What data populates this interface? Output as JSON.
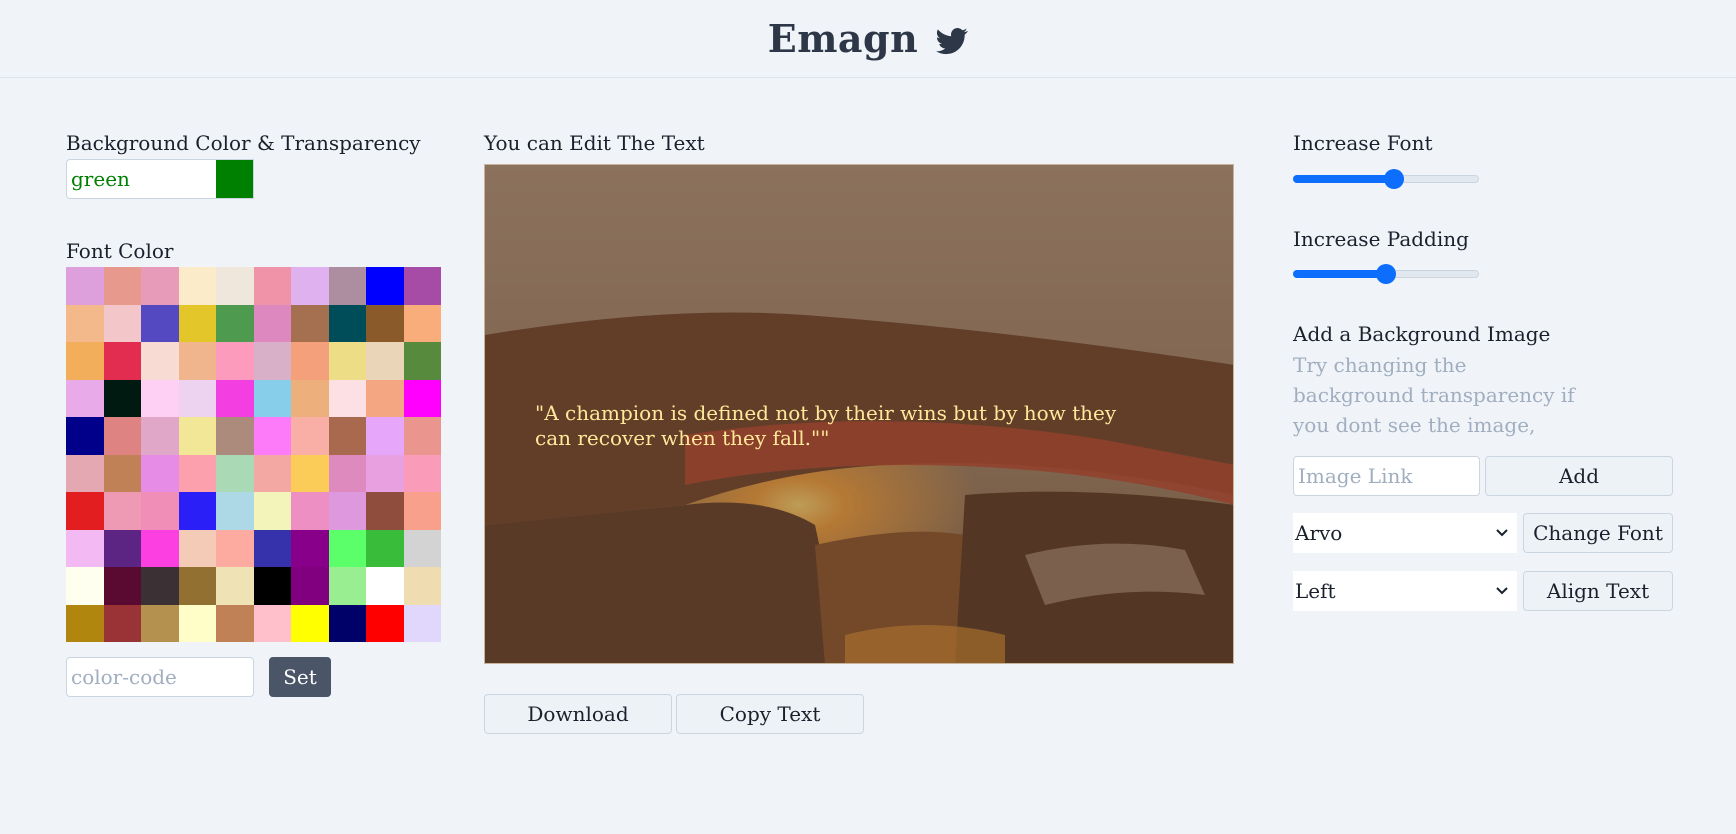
{
  "header": {
    "brand": "Emagn",
    "twitter_icon": "twitter-icon"
  },
  "left": {
    "bg_label": "Background Color & Transparency",
    "bg_value": "green",
    "bg_color": "#008000",
    "font_color_label": "Font Color",
    "palette": [
      "#dda0dd",
      "#e8998d",
      "#e89bb8",
      "#fbebc9",
      "#efe6dc",
      "#f093a8",
      "#dfb2ef",
      "#ad8ea0",
      "#0000ff",
      "#a64ca6",
      "#f4b98b",
      "#f3c6c9",
      "#5449c0",
      "#e3c62a",
      "#4e9a4e",
      "#de88c0",
      "#a5704f",
      "#004d5a",
      "#8b5a2b",
      "#f8ad7b",
      "#f3ae5c",
      "#e22d50",
      "#f8dcd3",
      "#f0b58c",
      "#fd9bbd",
      "#d8b1c8",
      "#f4a07a",
      "#eddd86",
      "#ead5b8",
      "#578a3c",
      "#e8aae9",
      "#001a11",
      "#fdd0f4",
      "#eed3f1",
      "#f33fe1",
      "#87ceeb",
      "#edaf7c",
      "#fde0e4",
      "#f4a582",
      "#ff00ff",
      "#00008b",
      "#de8282",
      "#e0a7c9",
      "#f2e697",
      "#ac8b7d",
      "#fd7af9",
      "#f9aea6",
      "#a9694f",
      "#e6a7fb",
      "#ea968f",
      "#e3a8b2",
      "#bf8155",
      "#e68ce6",
      "#fca0ad",
      "#aad9b6",
      "#f4a8a4",
      "#fbcc57",
      "#de8abf",
      "#e8a0e0",
      "#fb9bba",
      "#e21e20",
      "#ef9ab5",
      "#f18eb8",
      "#2a1ff6",
      "#add8e6",
      "#f2f4ba",
      "#ed8fc2",
      "#de99de",
      "#8f4e3d",
      "#f8a08b",
      "#f3b9f3",
      "#5c2483",
      "#fb3fe0",
      "#f3cbb7",
      "#fdaba1",
      "#3532ab",
      "#880089",
      "#5bff69",
      "#39bc3a",
      "#d3d3d3",
      "#fffff0",
      "#5a0a30",
      "#3b3134",
      "#927032",
      "#efe2b4",
      "#000000",
      "#800080",
      "#98ee90",
      "#ffffff",
      "#efdcb0",
      "#b1860f",
      "#993336",
      "#b4914f",
      "#fffec8",
      "#c08157",
      "#ffc0cb",
      "#ffff00",
      "#000069",
      "#ff0000",
      "#e1d6fb"
    ],
    "code_placeholder": "color-code",
    "set_label": "Set"
  },
  "center": {
    "edit_label": "You can Edit The Text",
    "quote": "\"A champion is defined not by their wins but by how they can recover when they fall.\"\"",
    "quote_color": "#ffe89a",
    "download_label": "Download",
    "copy_label": "Copy Text"
  },
  "right": {
    "font_label": "Increase Font",
    "font_slider_value": 0.55,
    "padding_label": "Increase Padding",
    "padding_slider_value": 0.5,
    "bg_image_label": "Add a Background Image",
    "bg_image_hint": "Try changing the background transparency if you dont see the image,",
    "image_link_placeholder": "Image Link",
    "add_label": "Add",
    "font_select_value": "Arvo",
    "change_font_label": "Change Font",
    "align_select_value": "Left",
    "align_text_label": "Align Text"
  }
}
